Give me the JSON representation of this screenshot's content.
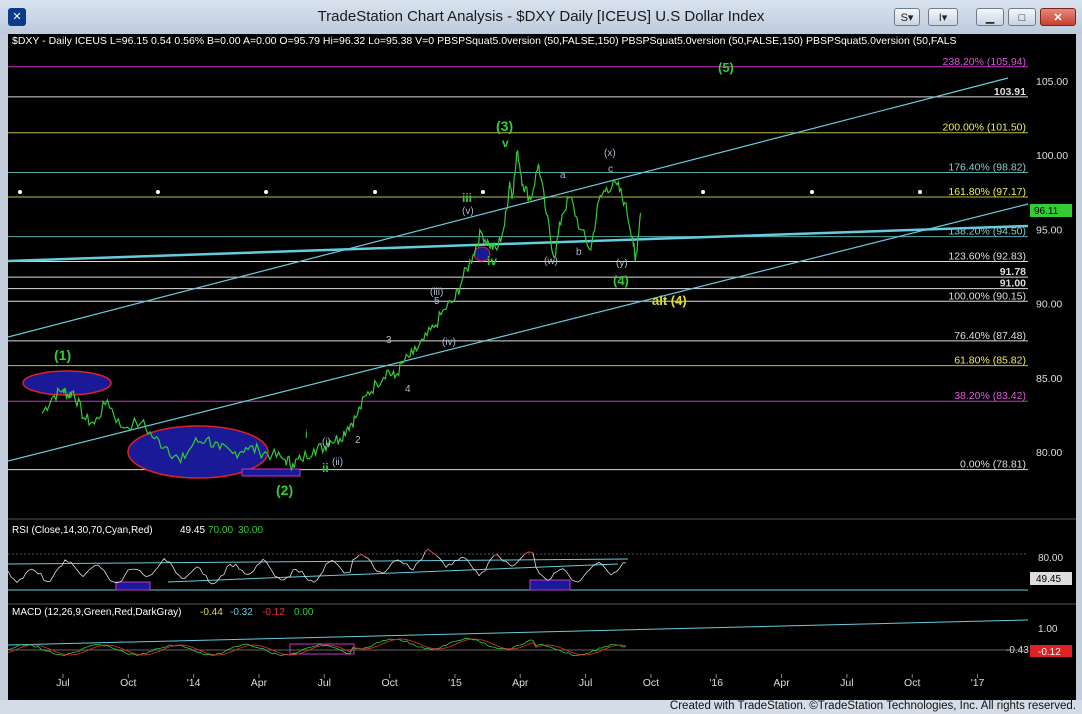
{
  "window": {
    "title": "TradeStation Chart Analysis - $DXY Daily [ICEUS] U.S Dollar Index",
    "buttons": [
      "S",
      "I"
    ]
  },
  "header_line": "$DXY - Daily  ICEUS  L=96.15  0.54  0.56%  B=0.00  A=0.00  O=95.79  Hi=96.32  Lo=95.38  V=0  PBSPSquat5.0version (50,FALSE,150)  PBSPSquat5.0version (50,FALSE,150)  PBSPSquat5.0version (50,FALS",
  "rsi_header": {
    "label": "RSI (Close,14,30,70,Cyan,Red)",
    "v1": "49.45",
    "v2": "70.00",
    "v3": "30.00"
  },
  "macd_header": {
    "label": "MACD (12,26,9,Green,Red,DarkGray)",
    "v1": "-0.44",
    "v2": "-0.32",
    "v3": "-0.12",
    "v4": "0.00"
  },
  "copyright": "Created with TradeStation. ©TradeStation Technologies, Inc. All rights reserved.",
  "colors": {
    "background": "#000000",
    "price": "#33cc33",
    "trendline": "#66ccdd",
    "fib_yellow": "#bbbb44",
    "magenta": "#cc33cc",
    "white_line": "#dddddd",
    "rsi_upper": "#cc3333",
    "blue_fill": "#1a1a99",
    "red_outline": "#dd2222"
  },
  "chart_data": [
    {
      "type": "line",
      "title": "$DXY Daily",
      "y_axis_ticks": [
        "105.00",
        "100.00",
        "95.00",
        "90.00",
        "85.00",
        "80.00"
      ],
      "x_axis_ticks": [
        "Jul",
        "Oct",
        "'14",
        "Apr",
        "Jul",
        "Oct",
        "'15",
        "Apr",
        "Jul",
        "Oct",
        "'16",
        "Apr",
        "Jul",
        "Oct",
        "'17"
      ],
      "last_price_label": "96.11",
      "price_path": [
        [
          2013.42,
          82.6
        ],
        [
          2013.46,
          83.7
        ],
        [
          2013.5,
          84.2
        ],
        [
          2013.52,
          83.8
        ],
        [
          2013.54,
          84.1
        ],
        [
          2013.58,
          82.3
        ],
        [
          2013.62,
          81.9
        ],
        [
          2013.67,
          83.5
        ],
        [
          2013.72,
          81.7
        ],
        [
          2013.8,
          82.0
        ],
        [
          2013.85,
          80.9
        ],
        [
          2013.9,
          80.3
        ],
        [
          2013.95,
          79.3
        ],
        [
          2014.0,
          80.6
        ],
        [
          2014.05,
          80.9
        ],
        [
          2014.1,
          80.2
        ],
        [
          2014.15,
          79.9
        ],
        [
          2014.2,
          80.3
        ],
        [
          2014.25,
          80.1
        ],
        [
          2014.3,
          79.8
        ],
        [
          2014.35,
          79.5
        ],
        [
          2014.38,
          79.2
        ],
        [
          2014.41,
          79.5
        ],
        [
          2014.46,
          80.2
        ],
        [
          2014.5,
          80.3
        ],
        [
          2014.52,
          80.8
        ],
        [
          2014.56,
          80.9
        ],
        [
          2014.59,
          81.7
        ],
        [
          2014.62,
          82.3
        ],
        [
          2014.66,
          83.8
        ],
        [
          2014.7,
          84.6
        ],
        [
          2014.74,
          85.5
        ],
        [
          2014.77,
          85.0
        ],
        [
          2014.8,
          86.0
        ],
        [
          2014.84,
          86.6
        ],
        [
          2014.88,
          87.5
        ],
        [
          2014.92,
          88.4
        ],
        [
          2014.96,
          89.6
        ],
        [
          2015.0,
          90.3
        ],
        [
          2015.03,
          91.7
        ],
        [
          2015.07,
          93.3
        ],
        [
          2015.1,
          94.8
        ],
        [
          2015.13,
          94.0
        ],
        [
          2015.16,
          93.6
        ],
        [
          2015.19,
          95.3
        ],
        [
          2015.21,
          98.2
        ],
        [
          2015.22,
          97.3
        ],
        [
          2015.24,
          100.3
        ],
        [
          2015.26,
          98.0
        ],
        [
          2015.29,
          97.0
        ],
        [
          2015.32,
          99.4
        ],
        [
          2015.35,
          96.0
        ],
        [
          2015.38,
          93.1
        ],
        [
          2015.41,
          96.0
        ],
        [
          2015.44,
          97.2
        ],
        [
          2015.48,
          95.0
        ],
        [
          2015.52,
          93.6
        ],
        [
          2015.55,
          96.9
        ],
        [
          2015.58,
          97.8
        ],
        [
          2015.62,
          98.0
        ],
        [
          2015.65,
          96.8
        ],
        [
          2015.68,
          94.5
        ],
        [
          2015.69,
          92.8
        ],
        [
          2015.71,
          96.1
        ]
      ],
      "horizontal_levels": [
        {
          "value": 105.94,
          "label": "238.20% (105.94)",
          "color": "magenta"
        },
        {
          "value": 103.91,
          "label": "103.91",
          "color": "white"
        },
        {
          "value": 101.5,
          "label": "200.00% (101.50)",
          "color": "yellow"
        },
        {
          "value": 98.82,
          "label": "176.40% (98.82)",
          "color": "teal"
        },
        {
          "value": 97.17,
          "label": "161.80% (97.17)",
          "color": "yellow"
        },
        {
          "value": 94.5,
          "label": "138.20% (94.50)",
          "color": "teal"
        },
        {
          "value": 92.83,
          "label": "123.60% (92.83)",
          "color": "white"
        },
        {
          "value": 91.78,
          "label": "91.78",
          "color": "white"
        },
        {
          "value": 91.0,
          "label": "91.00",
          "color": "white"
        },
        {
          "value": 90.15,
          "label": "100.00% (90.15)",
          "color": "white"
        },
        {
          "value": 87.48,
          "label": "76.40% (87.48)",
          "color": "white"
        },
        {
          "value": 85.82,
          "label": "61.80% (85.82)",
          "color": "yellow"
        },
        {
          "value": 83.42,
          "label": "38.20% (83.42)",
          "color": "magenta"
        },
        {
          "value": 78.81,
          "label": "0.00% (78.81)",
          "color": "white"
        }
      ],
      "wave_labels": [
        "(1)",
        "(2)",
        "(3)",
        "(4)",
        "(5)",
        "alt (4)",
        "i",
        "ii",
        "iii",
        "iv",
        "v",
        "(i)",
        "(ii)",
        "(iii)",
        "(iv)",
        "(v)",
        "1",
        "2",
        "3",
        "4",
        "5",
        "a",
        "b",
        "c",
        "(w)",
        "(x)",
        "(y)"
      ]
    },
    {
      "type": "line",
      "title": "RSI (Close,14,30,70,Cyan,Red)",
      "y_axis_ticks": [
        "80.00"
      ],
      "last_value_label": "49.45",
      "levels": [
        70,
        30
      ]
    },
    {
      "type": "line",
      "title": "MACD (12,26,9,Green,Red,DarkGray)",
      "y_axis_ticks": [
        "1.00"
      ],
      "value_labels": [
        "-0.43",
        "-0.12"
      ]
    }
  ]
}
